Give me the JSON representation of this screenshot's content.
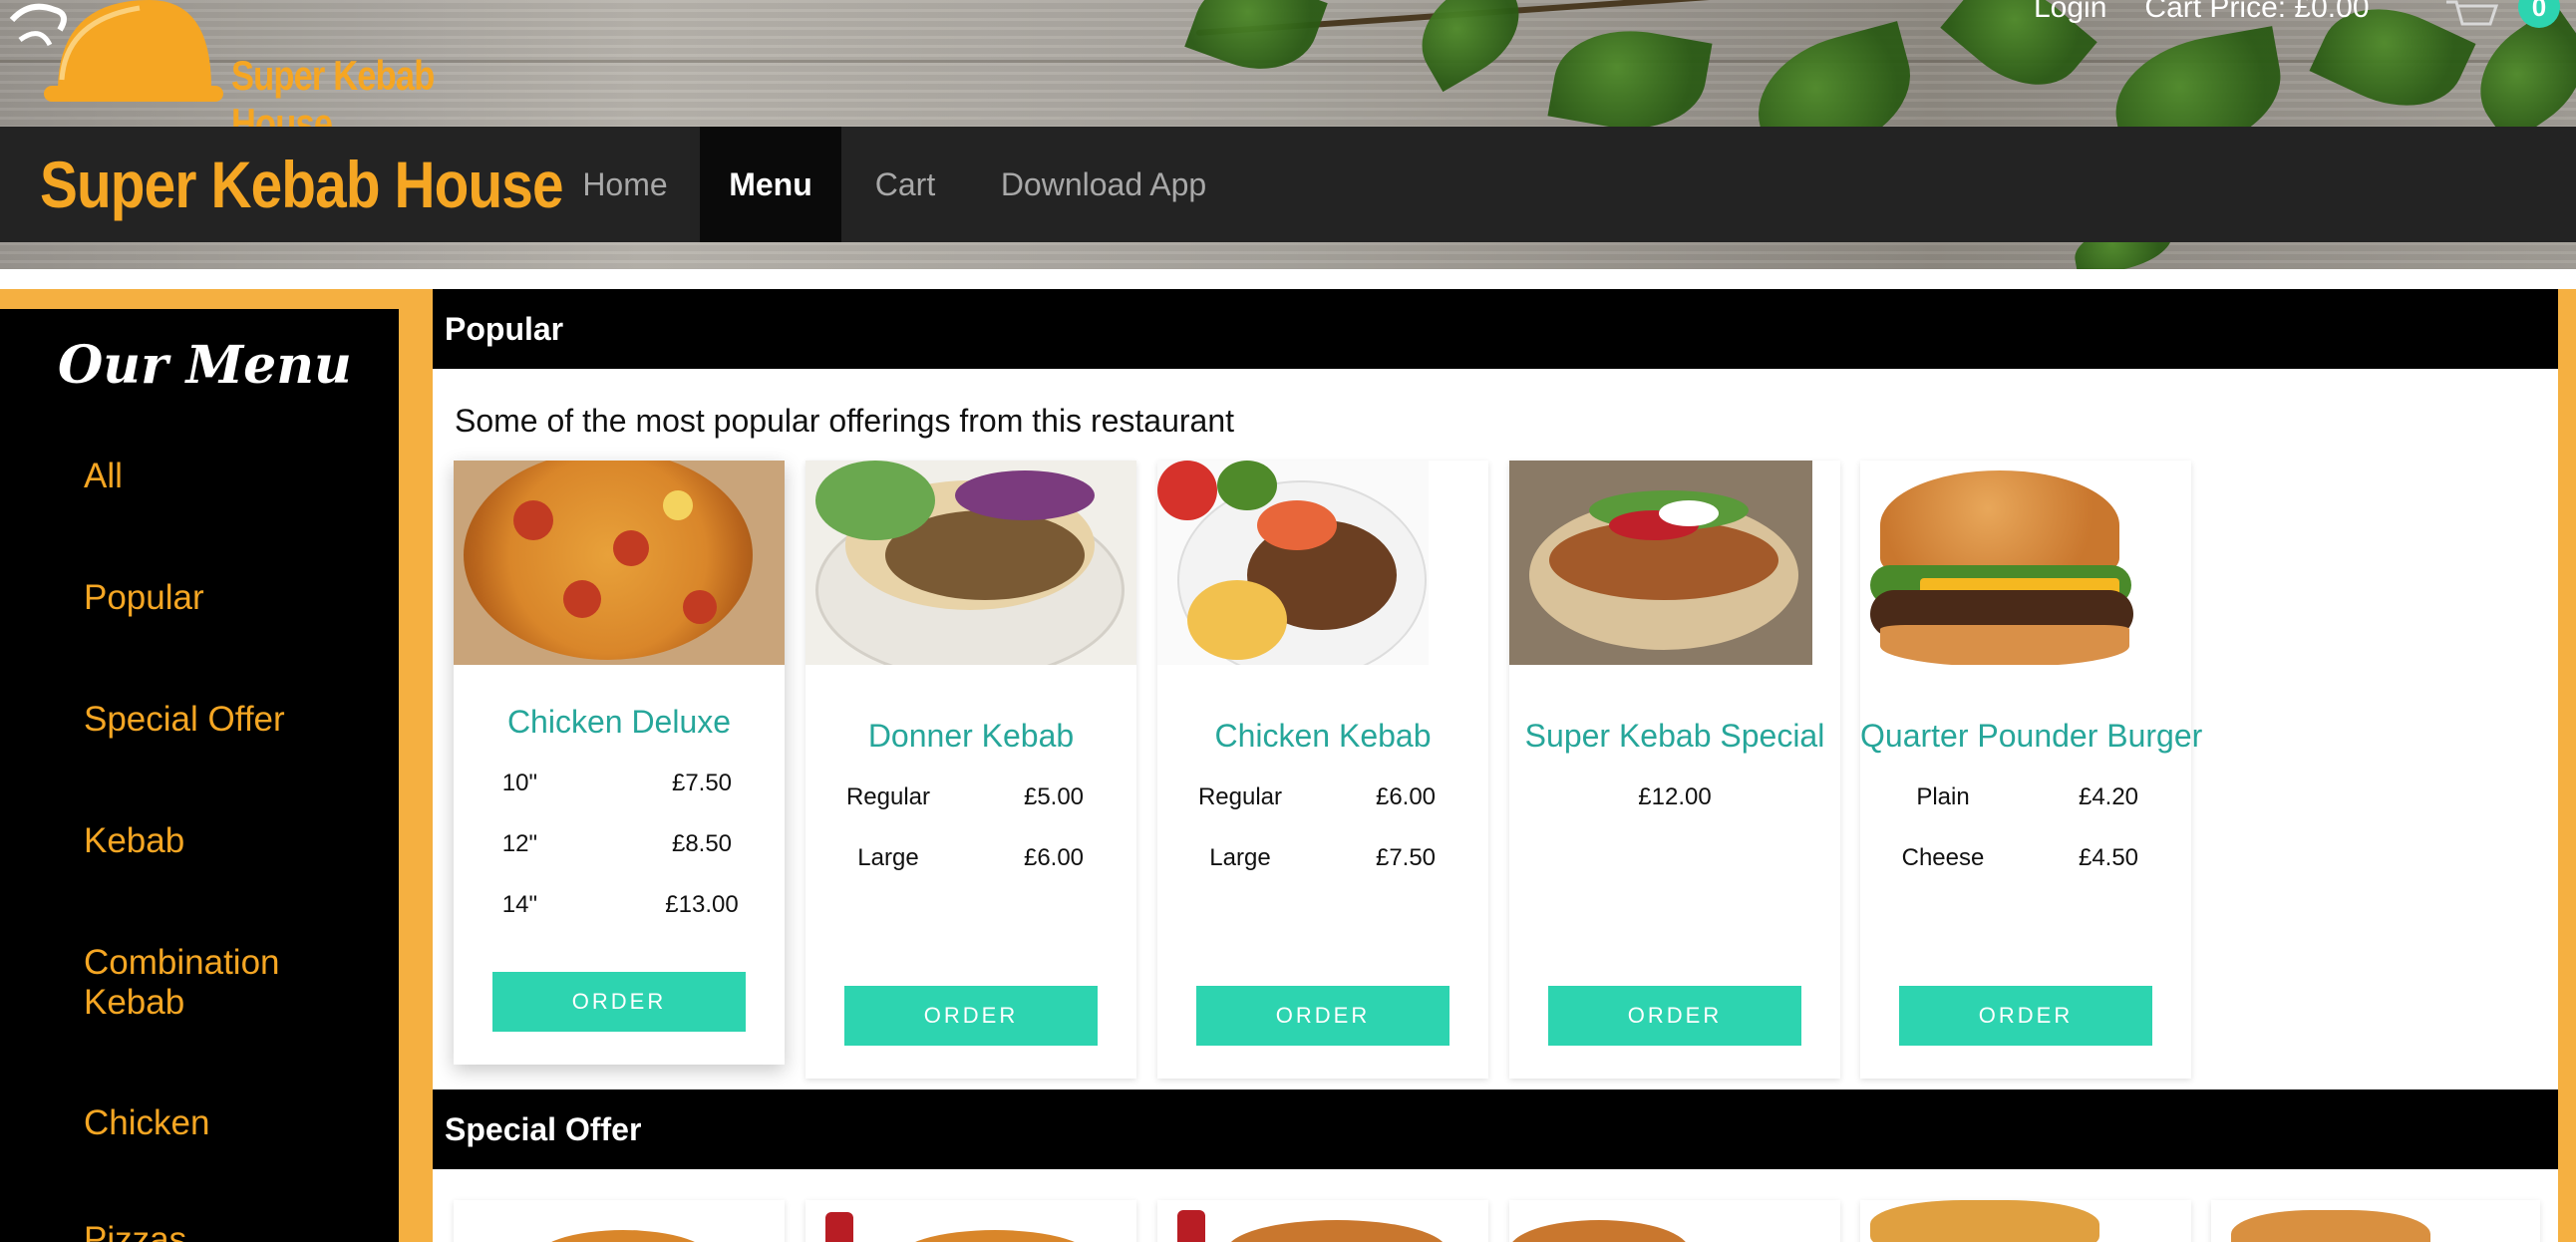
{
  "header": {
    "logo_text": "Super Kebab House",
    "login_label": "Login",
    "cart_price_label": "Cart Price: £0.00",
    "cart_count": "0"
  },
  "nav": {
    "brand": "Super Kebab House",
    "items": [
      {
        "label": "Home",
        "active": false
      },
      {
        "label": "Menu",
        "active": true
      },
      {
        "label": "Cart",
        "active": false
      },
      {
        "label": "Download App",
        "active": false
      }
    ]
  },
  "sidebar": {
    "title": "Our Menu",
    "items": [
      {
        "label": "All"
      },
      {
        "label": "Popular"
      },
      {
        "label": "Special Offer"
      },
      {
        "label": "Kebab"
      },
      {
        "label": "Combination Kebab"
      },
      {
        "label": "Chicken"
      },
      {
        "label": "Pizzas"
      }
    ]
  },
  "popular": {
    "title": "Popular",
    "description": "Some of the most popular offerings from this restaurant",
    "products": [
      {
        "name": "Chicken Deluxe",
        "image": "pizza",
        "prices": [
          {
            "size": "10\"",
            "price": "£7.50"
          },
          {
            "size": "12\"",
            "price": "£8.50"
          },
          {
            "size": "14\"",
            "price": "£13.00"
          }
        ],
        "order_label": "ORDER"
      },
      {
        "name": "Donner Kebab",
        "image": "donner-wrap",
        "prices": [
          {
            "size": "Regular",
            "price": "£5.00"
          },
          {
            "size": "Large",
            "price": "£6.00"
          }
        ],
        "order_label": "ORDER"
      },
      {
        "name": "Chicken Kebab",
        "image": "kebab-plate",
        "prices": [
          {
            "size": "Regular",
            "price": "£6.00"
          },
          {
            "size": "Large",
            "price": "£7.50"
          }
        ],
        "order_label": "ORDER"
      },
      {
        "name": "Super Kebab Special",
        "image": "kebab-wrap",
        "prices": [
          {
            "size": "",
            "price": "£12.00"
          }
        ],
        "order_label": "ORDER"
      },
      {
        "name": "Quarter Pounder Burger",
        "image": "burger",
        "prices": [
          {
            "size": "Plain",
            "price": "£4.20"
          },
          {
            "size": "Cheese",
            "price": "£4.50"
          }
        ],
        "order_label": "ORDER"
      }
    ]
  },
  "special_offer": {
    "title": "Special Offer"
  },
  "colors": {
    "accent_orange": "#f5a623",
    "teal_button": "#2dd4b0",
    "teal_text": "#26a69a",
    "navbar_bg": "#232323"
  }
}
